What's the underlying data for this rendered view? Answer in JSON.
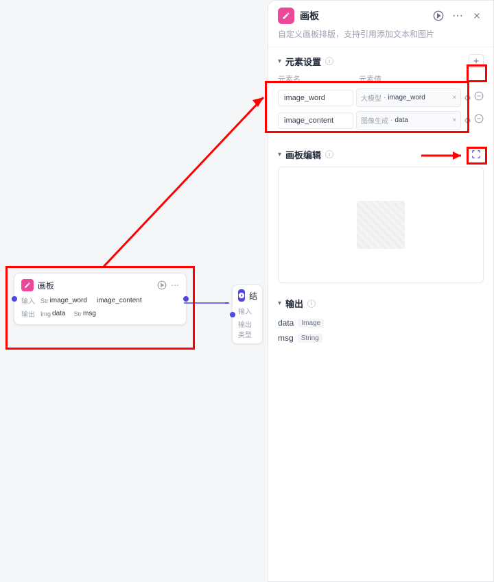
{
  "node1": {
    "title": "画板",
    "input_label": "输入",
    "output_label": "输出",
    "inputs": [
      {
        "type": "Str",
        "name": "image_word"
      },
      {
        "type": "",
        "name": "image_content"
      }
    ],
    "outputs": [
      {
        "type": "Img",
        "name": "data"
      },
      {
        "type": "Str",
        "name": "msg"
      }
    ]
  },
  "node2": {
    "title": "结",
    "input_label": "输入",
    "output_label": "输出类型"
  },
  "panel": {
    "title": "画板",
    "description": "自定义画板排版，支持引用添加文本和图片",
    "section_elements": "元素设置",
    "section_editor": "画板编辑",
    "section_output": "输出",
    "col_name": "元素名",
    "col_value": "元素值",
    "elements": [
      {
        "name": "image_word",
        "source": "大模型",
        "value": "image_word"
      },
      {
        "name": "image_content",
        "source": "图像生成",
        "value": "data"
      }
    ],
    "outputs": [
      {
        "name": "data",
        "type": "Image"
      },
      {
        "name": "msg",
        "type": "String"
      }
    ]
  }
}
